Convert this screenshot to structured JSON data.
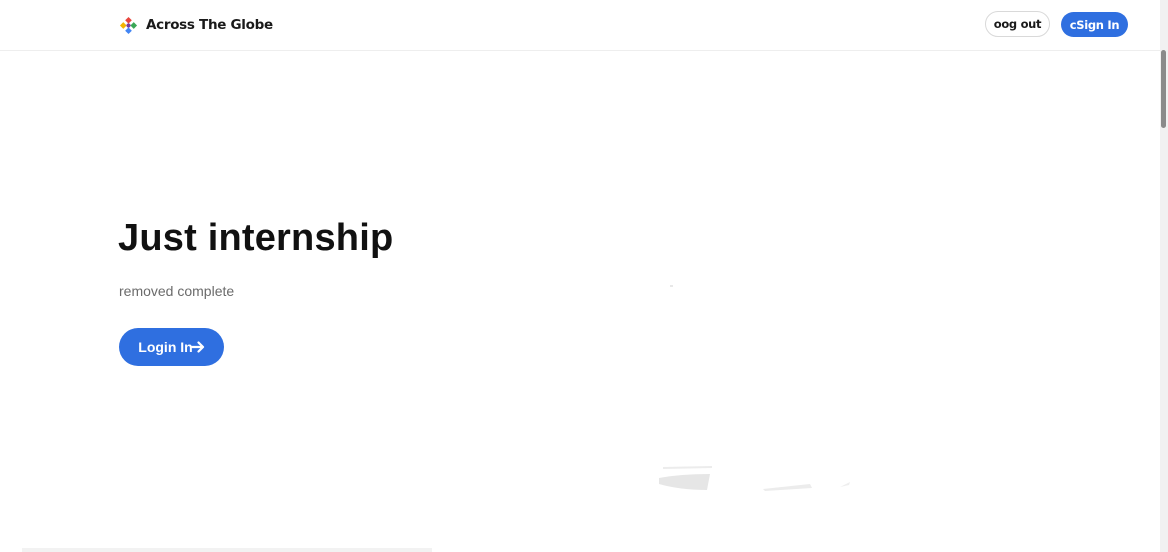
{
  "header": {
    "brand_name": "Across The Globe",
    "brand_logo_icon": "colorful-globe-logo-icon",
    "logout_label": "oog out",
    "signin_label": "cSign In"
  },
  "hero": {
    "title": "Just internship",
    "subtitle": "removed complete",
    "button_label": "Login In",
    "button_icon": "arrow-right-icon"
  },
  "colors": {
    "primary": "#2f6fe0",
    "title": "#111111",
    "subtitle": "#6b6b6b",
    "logo_red": "#e8453c",
    "logo_green": "#3aa757",
    "logo_blue": "#4285f4",
    "logo_yellow": "#f4b400"
  }
}
